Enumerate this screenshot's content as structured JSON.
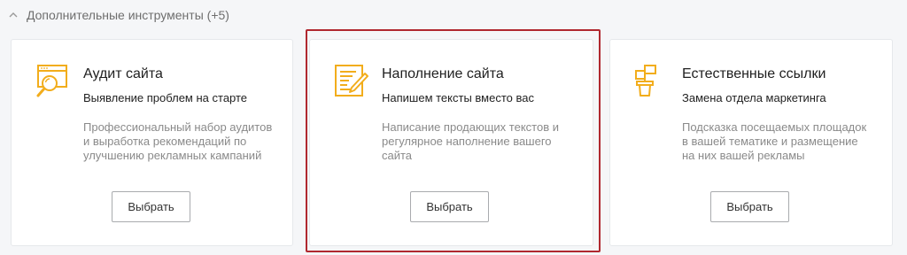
{
  "section": {
    "label": "Дополнительные инструменты (+5)",
    "toggle_icon": "chevron-up-icon"
  },
  "accent_color": "#f2ad1c",
  "highlight_color": "#b0282f",
  "cards": [
    {
      "icon": "website-audit-icon",
      "title": "Аудит сайта",
      "subtitle": "Выявление проблем на старте",
      "description": "Профессиональный набор аудитов и выработка рекомендаций по улучшению рекламных кампаний",
      "button": "Выбрать"
    },
    {
      "icon": "content-writing-icon",
      "title": "Наполнение сайта",
      "subtitle": "Напишем тексты вместо вас",
      "description": "Написание продающих текстов и регулярное наполнение вашего сайта",
      "button": "Выбрать"
    },
    {
      "icon": "plant-growth-icon",
      "title": "Естественные ссылки",
      "subtitle": "Замена отдела маркетинга",
      "description": "Подсказка посещаемых площадок в вашей тематике и размещение на них вашей рекламы",
      "button": "Выбрать"
    }
  ]
}
